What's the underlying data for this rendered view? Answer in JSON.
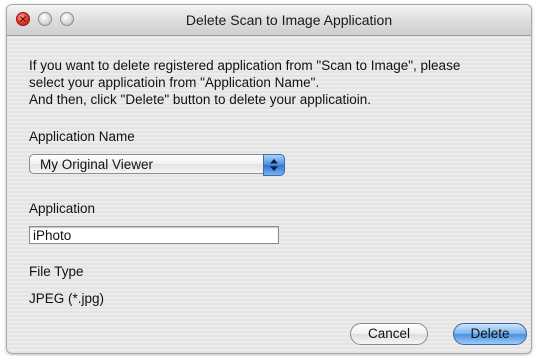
{
  "window": {
    "title": "Delete Scan to Image Application"
  },
  "instructions": {
    "line1": "If you want to delete registered application from \"Scan to Image\", please",
    "line2": "select your applicatioin from \"Application Name\".",
    "line3": "And then, click \"Delete\" button to delete your applicatioin."
  },
  "application_name": {
    "label": "Application Name",
    "selected": "My Original Viewer"
  },
  "application": {
    "label": "Application",
    "value": "iPhoto"
  },
  "file_type": {
    "label": "File Type",
    "value": "JPEG (*.jpg)"
  },
  "buttons": {
    "cancel": "Cancel",
    "delete": "Delete"
  },
  "colors": {
    "accent": "#4a90e2",
    "close_button": "#e8402f"
  },
  "icons": {
    "close": "close-icon",
    "minimize": "minimize-icon",
    "zoom": "zoom-icon",
    "popup_arrows": "updown-arrows-icon"
  }
}
